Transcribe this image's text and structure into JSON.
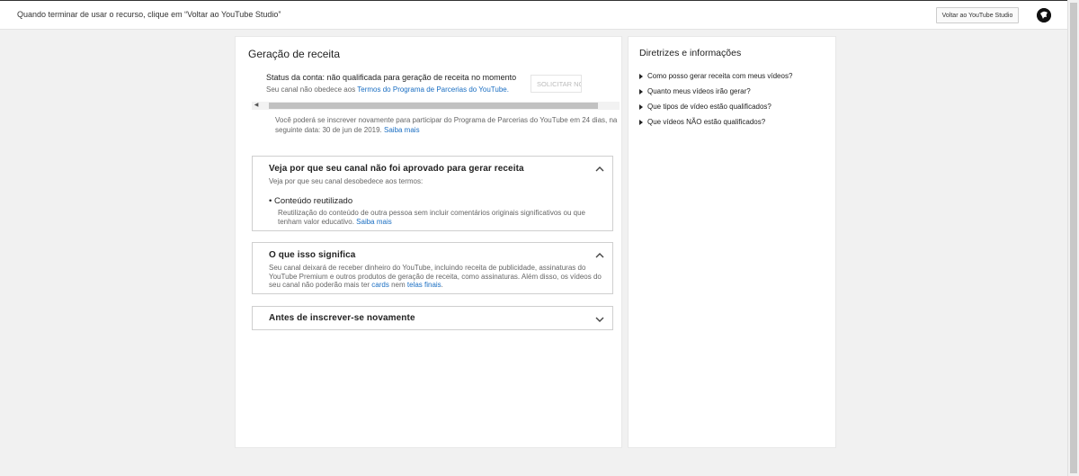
{
  "topbar": {
    "message": "Quando terminar de usar o recurso, clique em “Voltar ao YouTube Studio”",
    "back_button": "Voltar ao YouTube Studio"
  },
  "main": {
    "title": "Geração de receita",
    "status_line": "Status da conta: não qualificada para geração de receita no momento",
    "status_sub_prefix": "Seu canal não obedece aos ",
    "status_sub_link": "Termos do Programa de Parcerias do YouTube.",
    "request_button": "SOLICITAR NOVAMENTE",
    "reapply_note": "Você poderá se inscrever novamente para participar do Programa de Parcerias do YouTube em 24 dias, na seguinte data: 30 de jun de 2019.",
    "reapply_link": "Saiba mais",
    "panels": [
      {
        "title": "Veja por que seu canal não foi aprovado para gerar receita",
        "subtitle": "Veja por que seu canal desobedece aos termos:",
        "bullet_title": "Conteúdo reutilizado",
        "bullet_desc": "Reutilização do conteúdo de outra pessoa sem incluir comentários originais significativos ou que tenham valor educativo.",
        "bullet_link": "Saiba mais",
        "icon": "chevron-up-icon"
      },
      {
        "title": "O que isso significa",
        "body_prefix": "Seu canal deixará de receber dinheiro do YouTube, incluindo receita de publicidade, assinaturas do YouTube Premium e outros produtos de geração de receita, como assinaturas. Além disso, os vídeos do seu canal não poderão mais ter ",
        "body_link1": "cards",
        "body_mid": " nem ",
        "body_link2": "telas finais",
        "body_suffix": ".",
        "icon": "chevron-up-icon"
      },
      {
        "title": "Antes de inscrever-se novamente",
        "icon": "chevron-down-icon"
      }
    ]
  },
  "side": {
    "title": "Diretrizes e informações",
    "items": [
      "Como posso gerar receita com meus vídeos?",
      "Quanto meus vídeos irão gerar?",
      "Que tipos de vídeo estão qualificados?",
      "Que vídeos NÃO estão qualificados?"
    ]
  },
  "colors": {
    "link": "#1a6ec2",
    "background": "#f1f1f1"
  }
}
